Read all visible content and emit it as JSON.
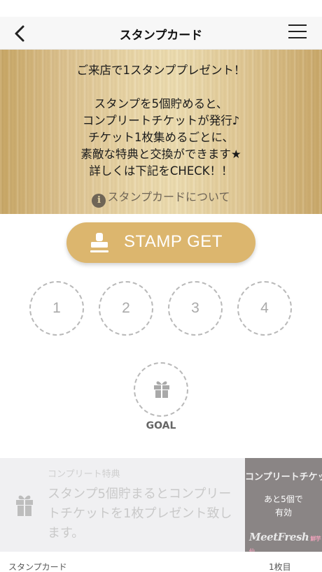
{
  "header": {
    "title": "スタンプカード",
    "back_icon": "chevron-left-icon",
    "menu_icon": "hamburger-menu-icon"
  },
  "banner": {
    "headline": "ご来店で1スタンププレゼント！",
    "lines": [
      "スタンプを5個貯めると、",
      "コンプリートチケットが発行♪",
      "チケット1枚集めるごとに、",
      "素敵な特典と交換ができます★",
      "詳しくは下記をCHECK！！"
    ],
    "link_label": "スタンプカードについて",
    "link_icon": "info-icon"
  },
  "stamp_button": {
    "label": "STAMP GET",
    "icon": "stamp-icon",
    "color": "#dcb66e"
  },
  "stamp_slots": [
    "1",
    "2",
    "3",
    "4"
  ],
  "goal": {
    "label": "GOAL",
    "icon": "gift-icon"
  },
  "complete_bonus": {
    "title": "コンプリート特典",
    "text": "スタンプ5個貯まるとコンプリートチケットを1枚プレゼント致します。",
    "icon": "gift-icon"
  },
  "complete_ticket": {
    "title": "コンプリートチケット",
    "note_line1": "あと5個で",
    "note_line2": "有効",
    "logo": "MeetFresh",
    "logo_sub": "鮮芋仙"
  },
  "footer": {
    "left": "スタンプカード",
    "right": "1枚目"
  }
}
